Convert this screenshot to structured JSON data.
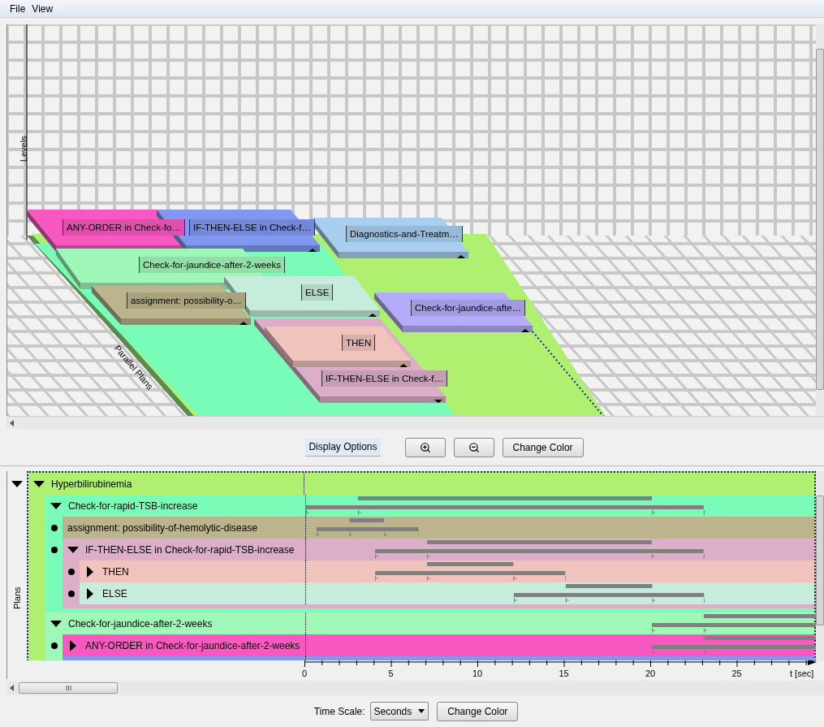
{
  "menu": [
    "File",
    "View"
  ],
  "view_3d": {
    "axis_labels": [
      "Levels",
      "Parallel Plans"
    ],
    "blocks": [
      {
        "label": "ANY-ORDER in Check-fo…",
        "color": "#f858c0"
      },
      {
        "label": "IF-THEN-ELSE in Check-f…",
        "color": "#8098f0"
      },
      {
        "label": "Diagnostics-and-Treatm…",
        "color": "#a8cff0"
      },
      {
        "label": "Check-for-jaundice-after-2-weeks",
        "color": "#a0f8b8"
      },
      {
        "label": "assignment: possibility-o…",
        "color": "#bcb48c"
      },
      {
        "label": "ELSE",
        "color": "#c6ecdc"
      },
      {
        "label": "Check-for-jaundice-afte…",
        "color": "#b4acf8"
      },
      {
        "label": "THEN",
        "color": "#f0c4bc"
      },
      {
        "label": "IF-THEN-ELSE in Check-f…",
        "color": "#dcaec8"
      }
    ]
  },
  "view_buttons": {
    "display_options": "Display Options",
    "change_color": "Change Color"
  },
  "plans": {
    "axis_label": "Plans",
    "expanded": true,
    "tree": {
      "label": "Hyperbilirubinemia",
      "color": "#b0f070",
      "expanded": true,
      "children": [
        {
          "label": "Check-for-rapid-TSB-increase",
          "color": "#78fcb8",
          "expanded": true,
          "children": [
            {
              "label": "assignment: possibility-of-hemolytic-disease",
              "color": "#bcb48c"
            },
            {
              "label": "IF-THEN-ELSE in Check-for-rapid-TSB-increase",
              "color": "#dcaec8",
              "expanded": true,
              "children": [
                {
                  "label": "THEN",
                  "color": "#f0c4bc",
                  "expanded": false
                },
                {
                  "label": "ELSE",
                  "color": "#c6ecdc",
                  "expanded": false
                }
              ]
            }
          ]
        },
        {
          "label": "Check-for-jaundice-after-2-weeks",
          "color": "#a0f8b8",
          "expanded": true,
          "children": [
            {
              "label": "ANY-ORDER in Check-for-jaundice-after-2-weeks",
              "color": "#f858c0",
              "expanded": false
            },
            {
              "color": "#8098f0"
            }
          ]
        }
      ]
    }
  },
  "timeline": {
    "ticks": [
      "0",
      "5",
      "10",
      "15",
      "20",
      "25"
    ],
    "unit": "t [sec]"
  },
  "footer": {
    "time_scale_label": "Time Scale:",
    "time_scale_value": "Seconds",
    "change_color": "Change Color"
  }
}
